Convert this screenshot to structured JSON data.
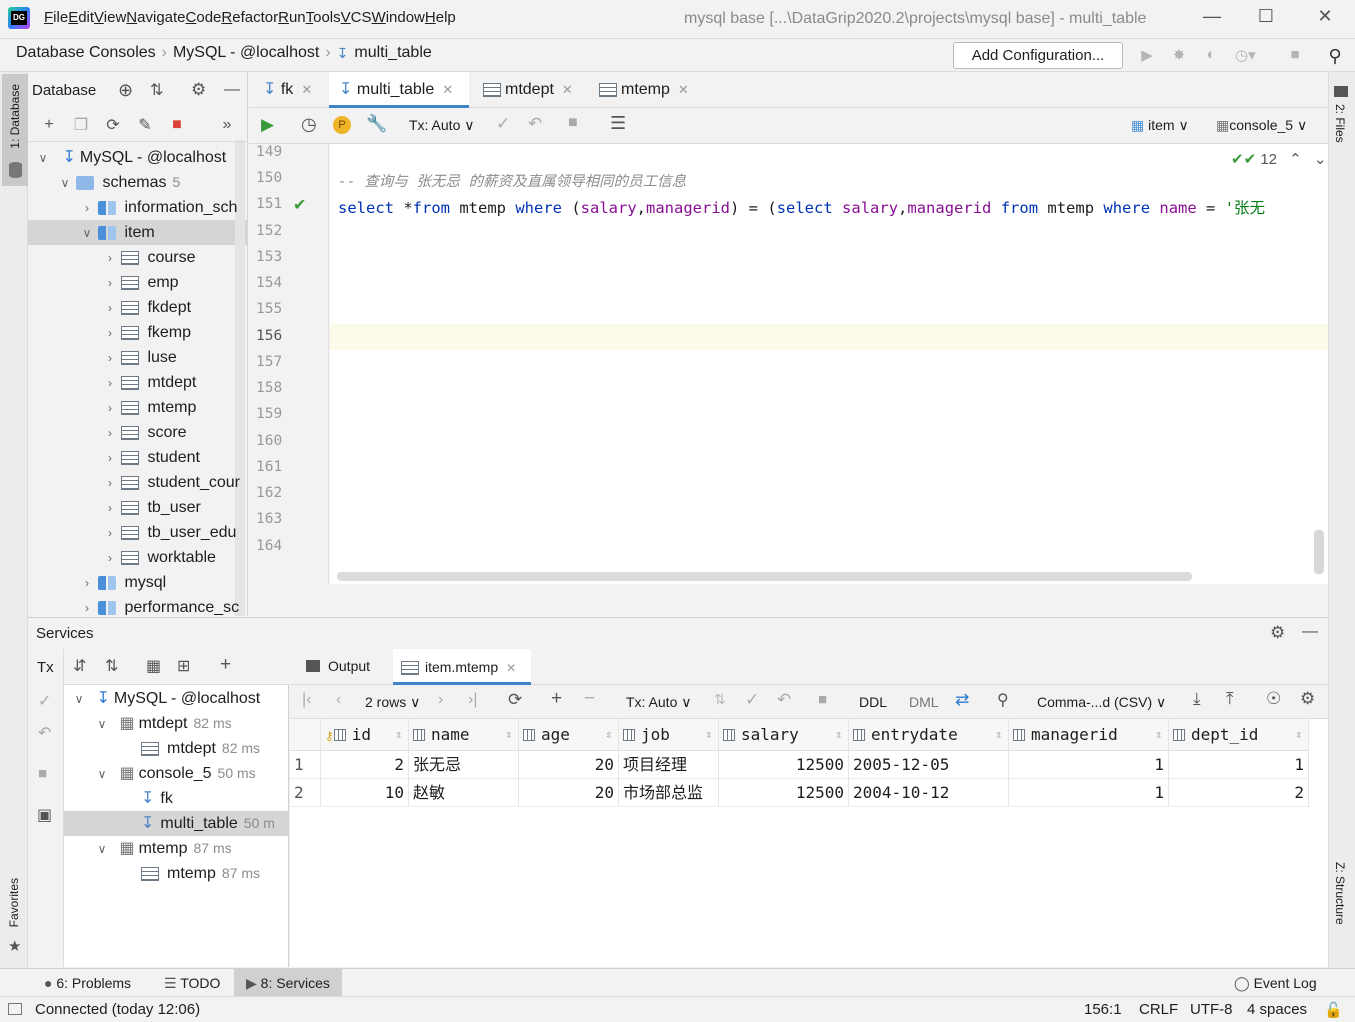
{
  "menu": {
    "items": [
      {
        "u": "F",
        "rest": "ile"
      },
      {
        "u": "E",
        "rest": "dit"
      },
      {
        "u": "V",
        "rest": "iew"
      },
      {
        "u": "N",
        "rest": "avigate"
      },
      {
        "u": "C",
        "rest": "ode"
      },
      {
        "u": "R",
        "rest": "efactor"
      },
      {
        "u": "R",
        "rest": "un"
      },
      {
        "u": "T",
        "rest": "ools"
      },
      {
        "u": "V",
        "rest": "CS"
      },
      {
        "u": "W",
        "rest": "indow"
      },
      {
        "u": "H",
        "rest": "elp"
      }
    ],
    "window_title": "mysql base [...\\DataGrip2020.2\\projects\\mysql base] - multi_table"
  },
  "breadcrumb": [
    "Database Consoles",
    "MySQL - @localhost",
    "multi_table"
  ],
  "toolbar": {
    "add_configuration": "Add Configuration..."
  },
  "left_strip": {
    "database": "1: Database",
    "favorites": "Favorites"
  },
  "right_strip": {
    "files": "2: Files",
    "structure": "Z: Structure"
  },
  "db_panel": {
    "title": "Database",
    "tree": [
      {
        "label": "MySQL - @localhost",
        "meta": "",
        "level": 0
      },
      {
        "label": "schemas",
        "meta": "5",
        "level": 1
      },
      {
        "label": "information_sch",
        "meta": "",
        "level": 2
      },
      {
        "label": "item",
        "meta": "",
        "level": 2
      },
      {
        "label": "course",
        "level": 3
      },
      {
        "label": "emp",
        "level": 3
      },
      {
        "label": "fkdept",
        "level": 3
      },
      {
        "label": "fkemp",
        "level": 3
      },
      {
        "label": "luse",
        "level": 3
      },
      {
        "label": "mtdept",
        "level": 3
      },
      {
        "label": "mtemp",
        "level": 3
      },
      {
        "label": "score",
        "level": 3
      },
      {
        "label": "student",
        "level": 3
      },
      {
        "label": "student_cour",
        "level": 3
      },
      {
        "label": "tb_user",
        "level": 3
      },
      {
        "label": "tb_user_edu",
        "level": 3
      },
      {
        "label": "worktable",
        "level": 3
      },
      {
        "label": "mysql",
        "level": 2
      },
      {
        "label": "performance_sc",
        "level": 2
      }
    ]
  },
  "editor": {
    "tabs": [
      "fk",
      "multi_table",
      "mtdept",
      "mtemp"
    ],
    "active_tab": "multi_table",
    "tx_mode": "Tx: Auto",
    "schema_selector": "item",
    "session_selector": "console_5",
    "inspection_count": "12",
    "line_numbers": [
      "149",
      "150",
      "151",
      "152",
      "153",
      "154",
      "155",
      "156",
      "157",
      "158",
      "159",
      "160",
      "161",
      "162",
      "163",
      "164"
    ],
    "comment_line": "-- 查询与 张无忌 的薪资及直属领导相同的员工信息",
    "code": {
      "t1": "select",
      "t2": " *",
      "t3": "from",
      "t4": " mtemp ",
      "t5": "where",
      "t6": " (",
      "t7": "salary",
      "t8": ",",
      "t9": "managerid",
      "t10": ") = (",
      "t11": "select",
      "t12": " ",
      "t13": "salary",
      "t14": ",",
      "t15": "managerid",
      "t16": " ",
      "t17": "from",
      "t18": " mtemp ",
      "t19": "where",
      "t20": " ",
      "t21": "name",
      "t22": " = ",
      "t23": "'张无"
    }
  },
  "services": {
    "title": "Services",
    "tree": [
      {
        "label": "MySQL - @localhost",
        "meta": ""
      },
      {
        "label": "mtdept",
        "meta": "82 ms"
      },
      {
        "label": "mtdept",
        "meta": "82 ms"
      },
      {
        "label": "console_5",
        "meta": "50 ms"
      },
      {
        "label": "fk",
        "meta": ""
      },
      {
        "label": "multi_table",
        "meta": "50 m"
      },
      {
        "label": "mtemp",
        "meta": "87 ms"
      },
      {
        "label": "mtemp",
        "meta": "87 ms"
      }
    ],
    "result_tabs": [
      "Output",
      "item.mtemp"
    ],
    "rows_label": "2 rows",
    "tx_mode": "Tx: Auto",
    "ddl": "DDL",
    "dml": "DML",
    "export_format": "Comma-...d (CSV)",
    "columns": [
      "id",
      "name",
      "age",
      "job",
      "salary",
      "entrydate",
      "managerid",
      "dept_id"
    ],
    "rows": [
      {
        "n": "1",
        "id": "2",
        "name": "张无忌",
        "age": "20",
        "job": "项目经理",
        "salary": "12500",
        "entrydate": "2005-12-05",
        "managerid": "1",
        "dept_id": "1"
      },
      {
        "n": "2",
        "id": "10",
        "name": "赵敏",
        "age": "20",
        "job": "市场部总监",
        "salary": "12500",
        "entrydate": "2004-10-12",
        "managerid": "1",
        "dept_id": "2"
      }
    ]
  },
  "bottom_tools": {
    "problems": "6: Problems",
    "todo": "TODO",
    "services": "8: Services",
    "event_log": "Event Log"
  },
  "status": {
    "connection": "Connected (today 12:06)",
    "position": "156:1",
    "line_sep": "CRLF",
    "encoding": "UTF-8",
    "indent": "4 spaces"
  }
}
